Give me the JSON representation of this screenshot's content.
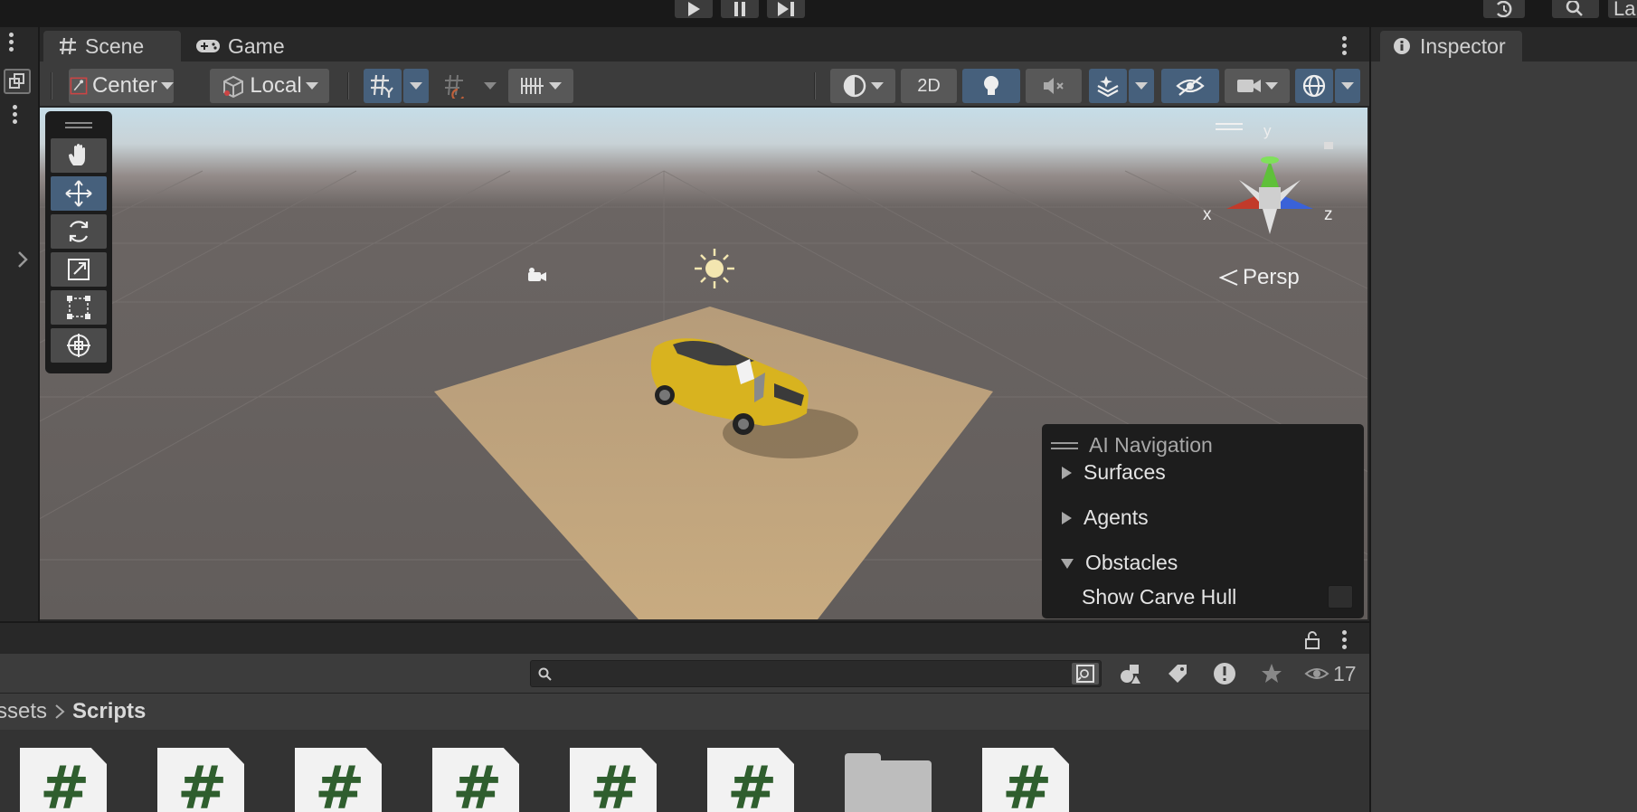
{
  "top_bar": {
    "play_icon": "play-icon",
    "pause_icon": "pause-icon",
    "step_icon": "step-icon",
    "history_icon": "history-icon",
    "search_icon": "search-icon",
    "layers_label": "La"
  },
  "scene_window": {
    "tabs": [
      {
        "label": "Scene",
        "icon": "hash-grid-icon"
      },
      {
        "label": "Game",
        "icon": "gamepad-icon"
      }
    ],
    "toolbar": {
      "pivot_label": "Center",
      "space_label": "Local",
      "mode_2d_label": "2D"
    },
    "viewport": {
      "projection_label": "Persp",
      "axes": {
        "x": "x",
        "y": "y",
        "z": "z"
      },
      "tools": [
        "hand-tool",
        "move-tool",
        "rotate-tool",
        "scale-tool",
        "rect-tool",
        "transform-tool"
      ],
      "selected_tool": "move-tool"
    },
    "ai_navigation": {
      "title": "AI Navigation",
      "sections": [
        {
          "label": "Surfaces",
          "expanded": false
        },
        {
          "label": "Agents",
          "expanded": false
        },
        {
          "label": "Obstacles",
          "expanded": true
        }
      ],
      "option_label": "Show Carve Hull",
      "option_checked": false
    }
  },
  "project_window": {
    "search_placeholder": "",
    "hidden_count": "17",
    "breadcrumb": [
      "ssets",
      "Scripts"
    ],
    "items": [
      "script",
      "script",
      "script",
      "script",
      "script",
      "script",
      "folder",
      "script"
    ]
  },
  "inspector": {
    "tab_label": "Inspector",
    "tab_icon": "info-icon"
  },
  "colors": {
    "accent_blue": "#46607c",
    "panel": "#3c3c3c",
    "dark_panel": "#282828",
    "script_hash_green": "#2f5e2e"
  }
}
